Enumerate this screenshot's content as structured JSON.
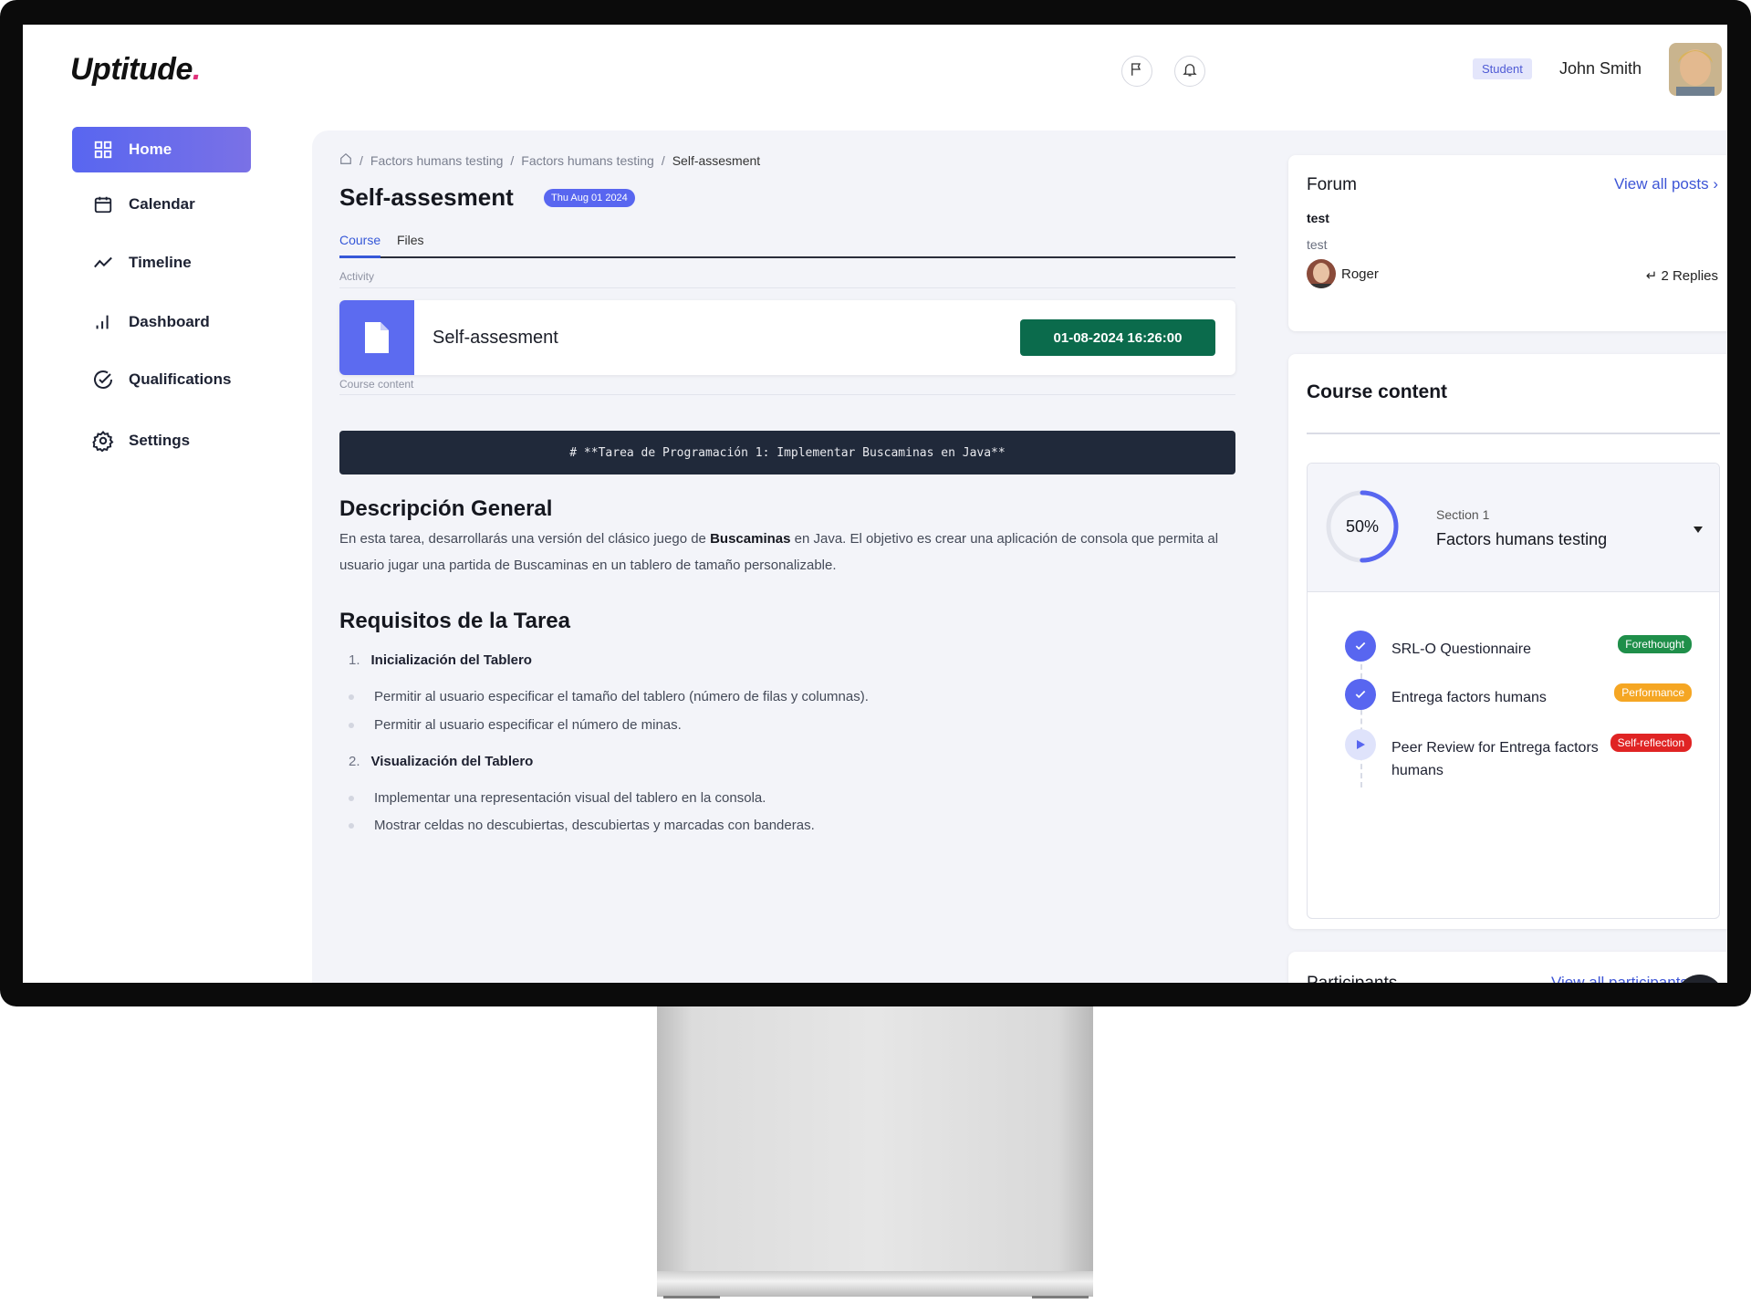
{
  "app": {
    "name": "Uptitude",
    "logo_dot": "."
  },
  "header": {
    "role_badge": "Student",
    "user_name": "John Smith"
  },
  "sidebar": {
    "items": [
      {
        "label": "Home",
        "icon": "grid-icon",
        "active": true
      },
      {
        "label": "Calendar",
        "icon": "calendar-icon",
        "active": false
      },
      {
        "label": "Timeline",
        "icon": "trend-line-icon",
        "active": false
      },
      {
        "label": "Dashboard",
        "icon": "bar-chart-icon",
        "active": false
      },
      {
        "label": "Qualifications",
        "icon": "check-circle-icon",
        "active": false
      },
      {
        "label": "Settings",
        "icon": "gear-icon",
        "active": false
      }
    ]
  },
  "breadcrumb": {
    "items": [
      "Factors humans testing",
      "Factors humans testing"
    ],
    "current": "Self-assesment"
  },
  "page": {
    "title": "Self-assesment",
    "date_badge": "Thu Aug 01 2024",
    "tabs": [
      "Course",
      "Files"
    ],
    "activity_label": "Activity",
    "activity": {
      "title": "Self-assesment",
      "datetime": "01-08-2024 16:26:00"
    },
    "course_content_label": "Course content",
    "code_header": "# **Tarea de Programación 1: Implementar Buscaminas en Java**",
    "desc_heading": "Descripción General",
    "desc_para_1": "En esta tarea, desarrollarás una versión del clásico juego de ",
    "desc_bold": "Buscaminas",
    "desc_para_2": " en Java. El objetivo es crear una aplicación de consola que permita al usuario jugar una partida de Buscaminas en un tablero de tamaño personalizable.",
    "req_heading": "Requisitos de la Tarea",
    "requirements": [
      {
        "num": "1.",
        "title": "Inicialización del Tablero",
        "items": [
          "Permitir al usuario especificar el tamaño del tablero (número de filas y columnas).",
          "Permitir al usuario especificar el número de minas."
        ]
      },
      {
        "num": "2.",
        "title": "Visualización del Tablero",
        "items": [
          "Implementar una representación visual del tablero en la consola.",
          "Mostrar celdas no descubiertas, descubiertas y marcadas con banderas."
        ]
      }
    ]
  },
  "forum": {
    "title": "Forum",
    "view_all": "View all posts ›",
    "post_title": "test",
    "post_body": "test",
    "author": "Roger",
    "replies": "↵ 2 Replies"
  },
  "course_content": {
    "title": "Course content",
    "section_sub": "Section 1",
    "section_name": "Factors humans testing",
    "progress_label": "50%",
    "progress_fraction": 0.5,
    "tasks": [
      {
        "name": "SRL-O Questionnaire",
        "tag": "Forethought",
        "tag_color": "#1f8f4a",
        "status": "done"
      },
      {
        "name": "Entrega factors humans",
        "tag": "Performance",
        "tag_color": "#f5a623",
        "status": "done"
      },
      {
        "name": "Peer Review for Entrega factors humans",
        "tag": "Self-reflection",
        "tag_color": "#e02424",
        "status": "play"
      }
    ]
  },
  "participants": {
    "title": "Participants",
    "view_all": "View all participants"
  },
  "colors": {
    "accent": "#5866f0",
    "success": "#0b6b4c",
    "code_bg": "#20293a"
  }
}
